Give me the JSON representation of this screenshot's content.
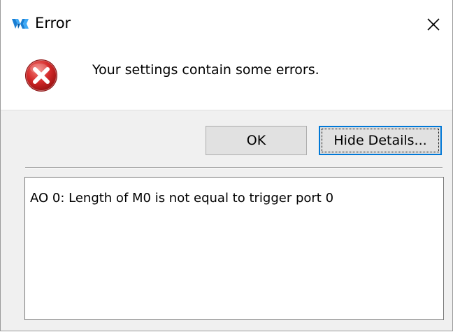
{
  "window": {
    "title": "Error",
    "app_icon": "gowin-logo-icon",
    "close_icon": "close-icon"
  },
  "message": {
    "icon": "error-icon",
    "text": "Your settings contain some errors."
  },
  "buttons": {
    "ok_label": "OK",
    "details_label": "Hide Details..."
  },
  "details": {
    "text": "AO 0: Length of M0 is not equal to trigger port 0"
  },
  "colors": {
    "error_red": "#d42a2a",
    "focus_blue": "#0078d7",
    "logo_blue": "#1a7fd4"
  }
}
